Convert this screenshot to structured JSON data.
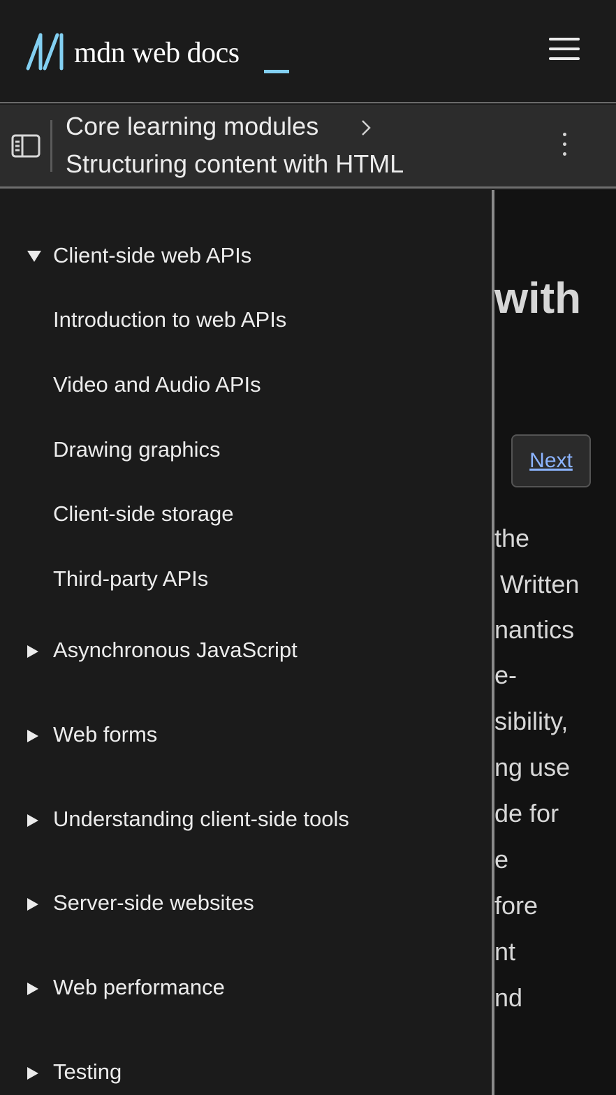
{
  "header": {
    "logo_text": "mdn web docs",
    "menu_icon": "hamburger-menu-icon"
  },
  "breadcrumb": {
    "sidebar_toggle_icon": "sidebar-toggle-icon",
    "parent": "Core learning modules",
    "current": "Structuring content with HTML",
    "more_icon": "more-options-icon"
  },
  "sidebar": {
    "expanded_section": {
      "label": "Client-side web APIs",
      "items": [
        "Introduction to web APIs",
        "Video and Audio APIs",
        "Drawing graphics",
        "Client-side storage",
        "Third-party APIs"
      ]
    },
    "collapsed_sections": [
      "Asynchronous JavaScript",
      "Web forms",
      "Understanding client-side tools",
      "Server-side websites",
      "Web performance",
      "Testing"
    ]
  },
  "main": {
    "heading_fragment": "with",
    "next_label": "Next",
    "body_fragments": [
      "the",
      "Written",
      "nantics",
      "e-",
      "sibility,",
      "ng use",
      "de for",
      "e",
      "fore",
      "nt",
      "nd"
    ]
  },
  "colors": {
    "background": "#1b1b1b",
    "toolbar": "#2c2c2c",
    "logo_accent": "#83d0f2",
    "link": "#8cb4ff"
  }
}
